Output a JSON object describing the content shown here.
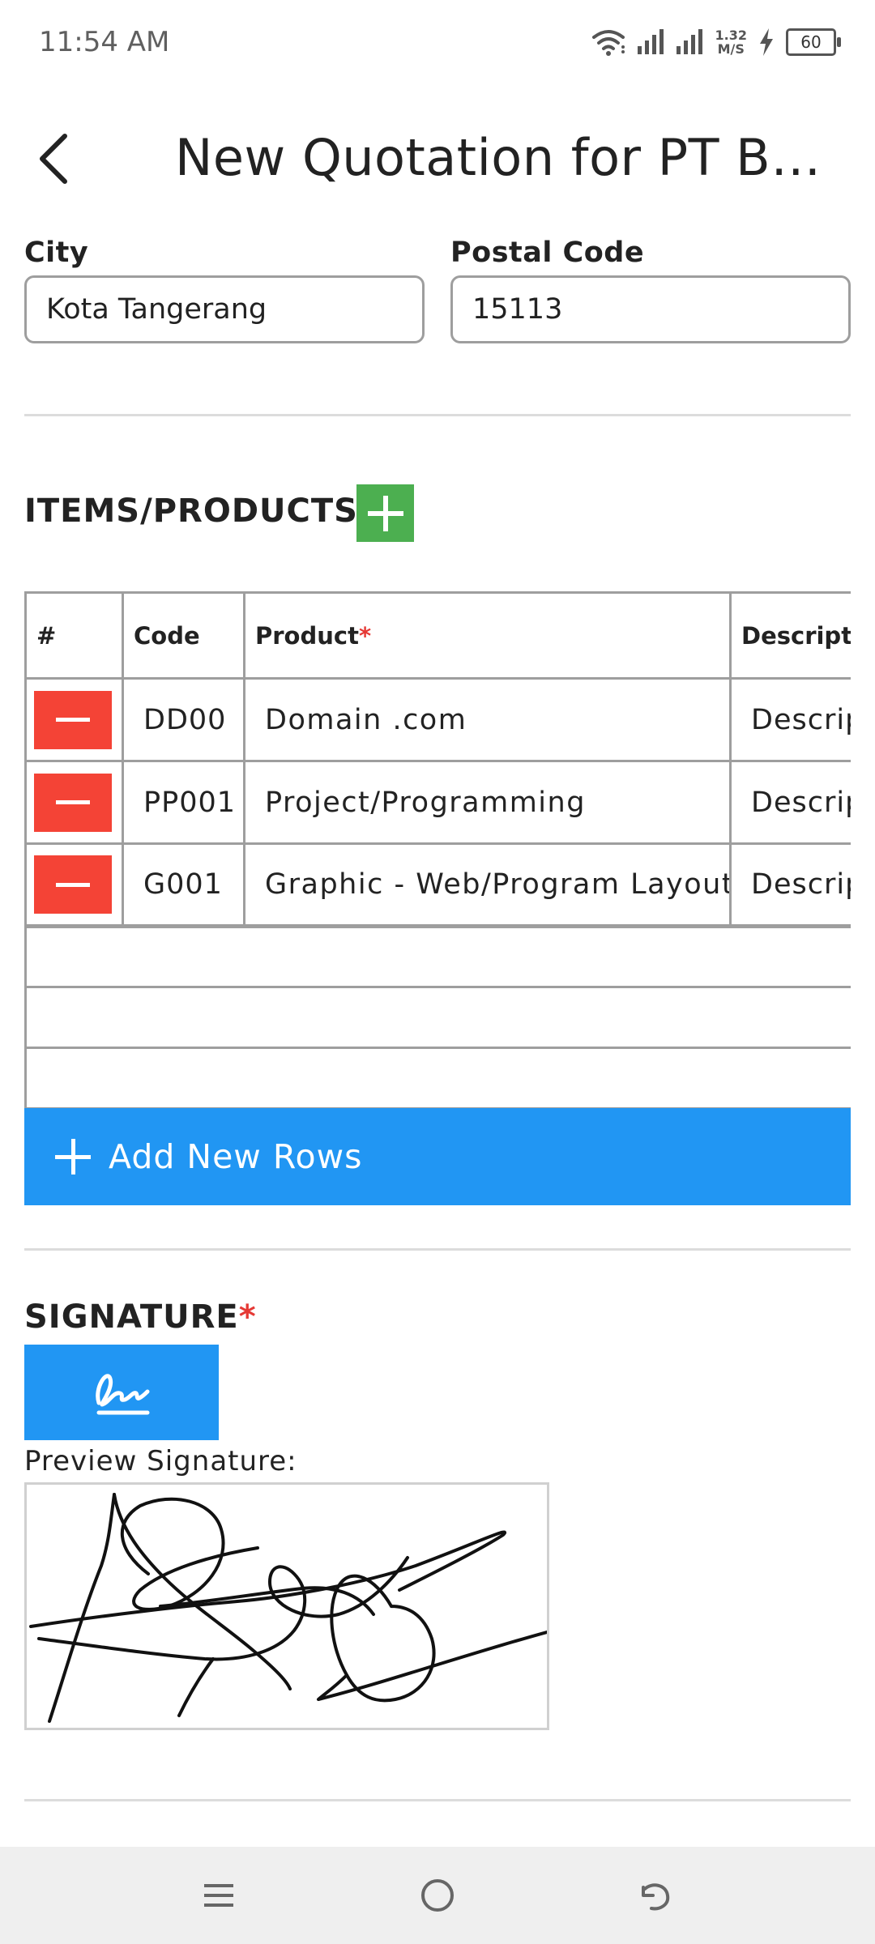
{
  "status_bar": {
    "time": "11:54 AM",
    "net_speed_value": "1.32",
    "net_speed_unit": "M/S",
    "battery": "60",
    "icons": [
      "wifi-icon",
      "signal-icon",
      "signal-icon",
      "charging-icon",
      "battery-icon"
    ]
  },
  "header": {
    "back_icon": "back-arrow-icon",
    "title": "New Quotation for PT Berka..."
  },
  "form": {
    "city_label": "City",
    "city_value": "Kota Tangerang",
    "postal_label": "Postal Code",
    "postal_value": "15113"
  },
  "items": {
    "title": "ITEMS/PRODUCTS",
    "add_icon": "plus-icon",
    "columns": {
      "num": "#",
      "code": "Code",
      "product": "Product",
      "description": "Description"
    },
    "required_mark": "*",
    "rows": [
      {
        "code": "DD00",
        "product": "Domain .com",
        "description_placeholder": "Description"
      },
      {
        "code": "PP001",
        "product": "Project/Programming",
        "description_placeholder": "Description"
      },
      {
        "code": "G001",
        "product": "Graphic - Web/Program Layout",
        "description_placeholder": "Description"
      }
    ],
    "add_rows_label": "Add New Rows"
  },
  "signature": {
    "title": "SIGNATURE",
    "required_mark": "*",
    "sign_icon": "signature-icon",
    "preview_label": "Preview Signature:"
  },
  "nav_bar": {
    "icons": [
      "menu-icon",
      "home-icon",
      "back-icon"
    ]
  },
  "colors": {
    "add_green": "#4caf50",
    "remove_red": "#f44336",
    "primary_blue": "#2196f3",
    "required_red": "#e53935"
  }
}
